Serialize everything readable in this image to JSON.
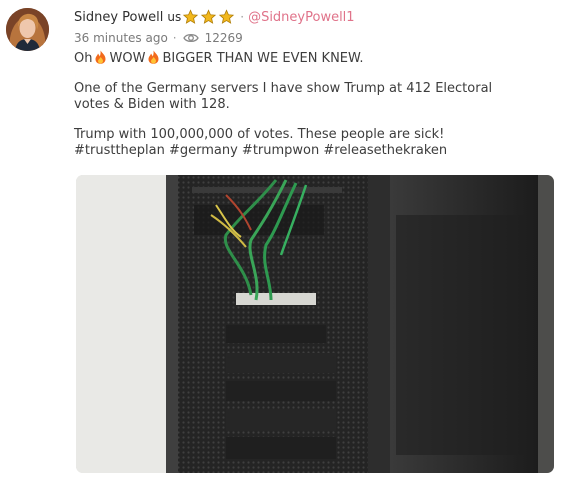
{
  "post": {
    "author": {
      "name": "Sidney Powell",
      "country": "us",
      "handle": "@SidneyPowell1",
      "avatar_icon": "profile-photo",
      "badges": [
        "star-icon",
        "star-icon",
        "star-icon"
      ]
    },
    "meta": {
      "time": "36 minutes ago",
      "separator": "·",
      "views": "12269",
      "views_icon": "eye-icon"
    },
    "body": {
      "line1_a": "Oh",
      "line1_b": "WOW",
      "line1_c": "BIGGER THAN WE EVEN KNEW.",
      "line2": "One of the Germany servers I have show Trump at 412 Electoral",
      "line3": "votes & Biden with 128.",
      "line4": "Trump with 100,000,000 of votes. These people are sick!",
      "line5": "#trusttheplan #germany #trumpwon #releasethekraken",
      "emoji_icon": "fire-icon"
    },
    "media": {
      "type": "photo",
      "subject": "server-rack-photo"
    },
    "colors": {
      "handle": "#e0738a",
      "star": "#f2b81d",
      "text": "#3d3d3d",
      "meta": "#7a7a7a"
    }
  }
}
